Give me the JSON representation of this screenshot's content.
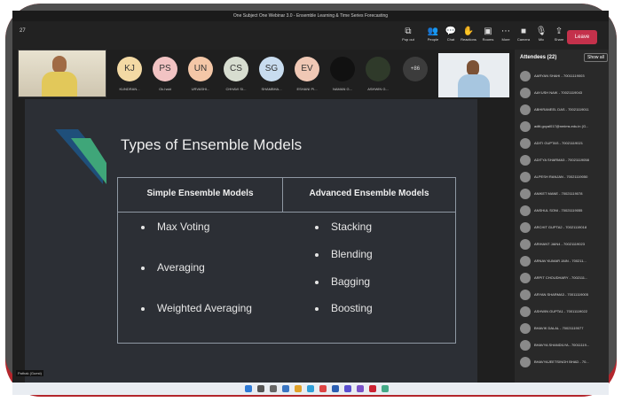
{
  "window": {
    "title": "One Subject One Webinar 3.0 - Ensemble Learning & Time Series Forecasting",
    "clock": "27"
  },
  "toolbar": [
    {
      "icon": "pop-out-icon",
      "glyph": "⧉",
      "label": "Pop out"
    },
    {
      "icon": "people-icon",
      "glyph": "👥",
      "label": "People"
    },
    {
      "icon": "chat-icon",
      "glyph": "💬",
      "label": "Chat"
    },
    {
      "icon": "reactions-icon",
      "glyph": "✋",
      "label": "Reactions"
    },
    {
      "icon": "rooms-icon",
      "glyph": "▣",
      "label": "Rooms"
    },
    {
      "icon": "more-icon",
      "glyph": "⋯",
      "label": "More"
    },
    {
      "icon": "camera-icon",
      "glyph": "■",
      "label": "Camera"
    },
    {
      "icon": "mic-icon",
      "glyph": "🎙",
      "label": "Mic"
    },
    {
      "icon": "share-icon",
      "glyph": "⇪",
      "label": "Share"
    }
  ],
  "leave_label": "Leave",
  "participants": [
    {
      "initials": "KJ",
      "name": "KUNDRAN...",
      "color": "#f3d9a4"
    },
    {
      "initials": "PS",
      "name": "Ok.haid",
      "color": "#f2c3c3"
    },
    {
      "initials": "UN",
      "name": "URVASHI...",
      "color": "#f4c7a7"
    },
    {
      "initials": "CS",
      "name": "CHHAVI SI...",
      "color": "#d7ddd0"
    },
    {
      "initials": "SG",
      "name": "SHAMBHA...",
      "color": "#c8dcef"
    },
    {
      "initials": "EV",
      "name": "ESHANI PI...",
      "color": "#f0c8b5"
    },
    {
      "initials": "",
      "name": "NAMAN G...",
      "color": "#111111"
    },
    {
      "initials": "",
      "name": "ASHWIN G...",
      "color": "#2f3a2a"
    }
  ],
  "more_participants": "+86",
  "slide": {
    "title": "Types of Ensemble Models",
    "columns": [
      {
        "header": "Simple Ensemble Models",
        "items": [
          "Max Voting",
          "Averaging",
          "Weighted Averaging"
        ]
      },
      {
        "header": "Advanced Ensemble Models",
        "items": [
          "Stacking",
          "Blending",
          "Bagging",
          "Boosting"
        ]
      }
    ]
  },
  "presenter_label": "Pathak (Guest)",
  "attendees": {
    "heading": "Attendees (22)",
    "show_all": "Show all",
    "list": [
      "AARYAN SHAHI - 70011119003",
      "AAYUSH NAIK - 70021119043",
      "ABHIRANEEL DAS - 70021119011",
      "aditi.goyal017@nmims.edu.in (G...",
      "ADITI GUPTAS - 70021119021",
      "ADITYA SHARMA3 - 70021119058",
      "ALPESH RANJAN - 70021119050",
      "ANIKET MANE - 70021119078",
      "ANSHUL SONI - 70021119055",
      "ARCHIT GUPTA2 - 70021119018",
      "ARIHANT JAIN4 - 70021119023",
      "ARNAV KUMAR JAIN - 700211...",
      "ARPIT CHOUDHARY - 7002111...",
      "ARYAN SHARMA3 - 70011119005",
      "ASHWIN GUPTA1 - 70011119022",
      "BHAVIK DALAL - 70021119077",
      "BHAVYA SHANDILYA - 70011119...",
      "BHAVYAJEETSINGH BHAD - 70..."
    ]
  }
}
